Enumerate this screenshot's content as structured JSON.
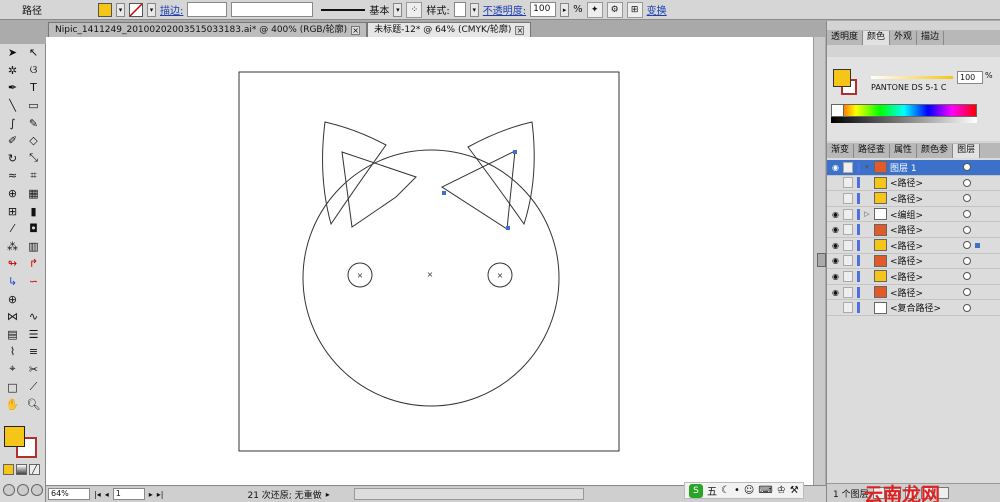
{
  "control_bar": {
    "selection_label": "路径",
    "fill_color": "#f5c518",
    "stroke_label": "描边:",
    "stroke_style_label": "基本",
    "style_label": "样式:",
    "opacity_label": "不透明度:",
    "opacity_value": "100",
    "opacity_unit": "%",
    "transform_label": "变换"
  },
  "tabs": [
    {
      "label": "Nipic_1411249_20100202003515033183.ai* @ 400% (RGB/轮廓)",
      "active": false
    },
    {
      "label": "未标题-12* @ 64% (CMYK/轮廓)",
      "active": true
    }
  ],
  "status_bar": {
    "zoom": "64%",
    "page": "1",
    "message": "21 次还原; 无重做"
  },
  "ime_bar": {
    "logo": "S",
    "mode": "五"
  },
  "panels": {
    "top_tabs": [
      "透明度",
      "颜色",
      "外观",
      "描边"
    ],
    "color": {
      "swatch_name": "PANTONE DS 5-1 C",
      "tint_value": "100",
      "tint_unit": "%"
    },
    "mid_tabs": [
      "渐变",
      "路径查",
      "属性",
      "颜色参",
      "图层"
    ]
  },
  "layers": {
    "rows": [
      {
        "name": "图层 1",
        "eye": true,
        "expanded": true,
        "thumb": "#e05a2a",
        "header": true
      },
      {
        "name": "<路径>",
        "eye": false,
        "thumb": "#f5c518"
      },
      {
        "name": "<路径>",
        "eye": false,
        "thumb": "#f5c518"
      },
      {
        "name": "<编组>",
        "eye": true,
        "thumb": "#ffffff",
        "group": true
      },
      {
        "name": "<路径>",
        "eye": true,
        "thumb": "#e05a2a"
      },
      {
        "name": "<路径>",
        "eye": true,
        "thumb": "#f5c518",
        "selected": true
      },
      {
        "name": "<路径>",
        "eye": true,
        "thumb": "#e05a2a"
      },
      {
        "name": "<路径>",
        "eye": true,
        "thumb": "#f5c518"
      },
      {
        "name": "<路径>",
        "eye": true,
        "thumb": "#e05a2a"
      },
      {
        "name": "<复合路径>",
        "eye": false,
        "thumb": "#ffffff"
      }
    ],
    "footer_count": "1 个图层"
  },
  "watermark": "云南龙网"
}
